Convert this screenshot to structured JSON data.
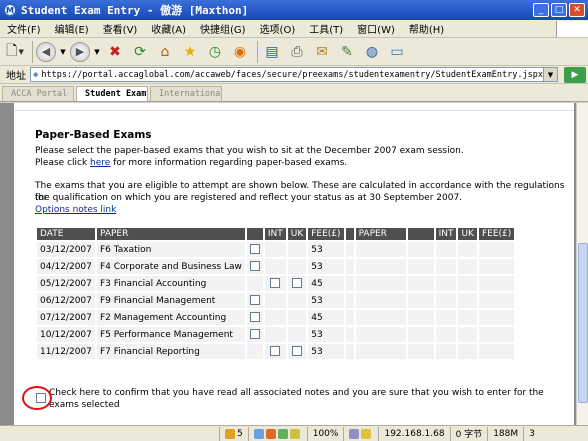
{
  "window": {
    "title": "Student Exam Entry - 傲游 [Maxthon]"
  },
  "menu": [
    "文件(F)",
    "编辑(E)",
    "查看(V)",
    "收藏(A)",
    "快捷组(G)",
    "选项(O)",
    "工具(T)",
    "窗口(W)",
    "帮助(H)"
  ],
  "toolbar": {
    "icons": [
      "new-page-icon",
      "back-icon",
      "forward-icon",
      "stop-icon",
      "refresh-icon",
      "home-icon",
      "favorites-star-icon",
      "history-icon",
      "rss-icon",
      "sidebar-icon",
      "print-icon",
      "mail-icon",
      "tools-icon",
      "web-services-icon",
      "screen-capture-icon"
    ]
  },
  "address": {
    "label": "地址",
    "url": "https://portal.accaglobal.com/accaweb/faces/secure/preexams/studentexamentry/StudentExamEntry.jspx#",
    "go_arrow": "▶"
  },
  "tabs": [
    "ACCA Portal",
    "Student Exam...",
    "Internationa..."
  ],
  "page": {
    "section_title": "Paper-Based Exams",
    "intro_line1": "Please select the paper-based exams that you wish to sit at the December 2007 exam session.",
    "intro_line2_pre": "Please click ",
    "intro_line2_link": "here",
    "intro_line2_post": " for more information regarding paper-based exams.",
    "eligible_line1": "The exams that you are eligible to attempt are shown below. These are calculated in accordance with the regulations for",
    "eligible_line2": "the qualification on which you are registered and reflect your status as at 30 September 2007.",
    "options_link": "Options notes link",
    "table": {
      "headers": [
        "DATE",
        "PAPER",
        "",
        "INT",
        "UK",
        "FEE(£)",
        "",
        "PAPER",
        "",
        "INT",
        "UK",
        "FEE(£)"
      ],
      "rows": [
        {
          "date": "03/12/2007",
          "paper": "F6 Taxation",
          "main_cb": true,
          "int_cb": false,
          "uk_cb": false,
          "fee": "53"
        },
        {
          "date": "04/12/2007",
          "paper": "F4 Corporate and Business Law",
          "main_cb": true,
          "int_cb": false,
          "uk_cb": false,
          "fee": "53"
        },
        {
          "date": "05/12/2007",
          "paper": "F3 Financial Accounting",
          "main_cb": false,
          "int_cb": true,
          "uk_cb": true,
          "fee": "45"
        },
        {
          "date": "06/12/2007",
          "paper": "F9 Financial Management",
          "main_cb": true,
          "int_cb": false,
          "uk_cb": false,
          "fee": "53"
        },
        {
          "date": "07/12/2007",
          "paper": "F2 Management Accounting",
          "main_cb": true,
          "int_cb": false,
          "uk_cb": false,
          "fee": "45"
        },
        {
          "date": "10/12/2007",
          "paper": "F5 Performance Management",
          "main_cb": true,
          "int_cb": false,
          "uk_cb": false,
          "fee": "53"
        },
        {
          "date": "11/12/2007",
          "paper": "F7 Financial Reporting",
          "main_cb": false,
          "int_cb": true,
          "uk_cb": true,
          "fee": "53"
        }
      ]
    },
    "confirm_text": "Check here to confirm that you have read all associated notes and you are sure that you wish to enter for the exams selected"
  },
  "status": {
    "count": "5",
    "zoom": "100%",
    "ip": "192.168.1.68",
    "bytes": "0 字节",
    "memory": "188M",
    "windows": "3"
  },
  "colors": {
    "title_bar": "#1747b8",
    "table_header": "#4f4f4f",
    "highlight_ring": "#e01010",
    "link": "#003399"
  }
}
